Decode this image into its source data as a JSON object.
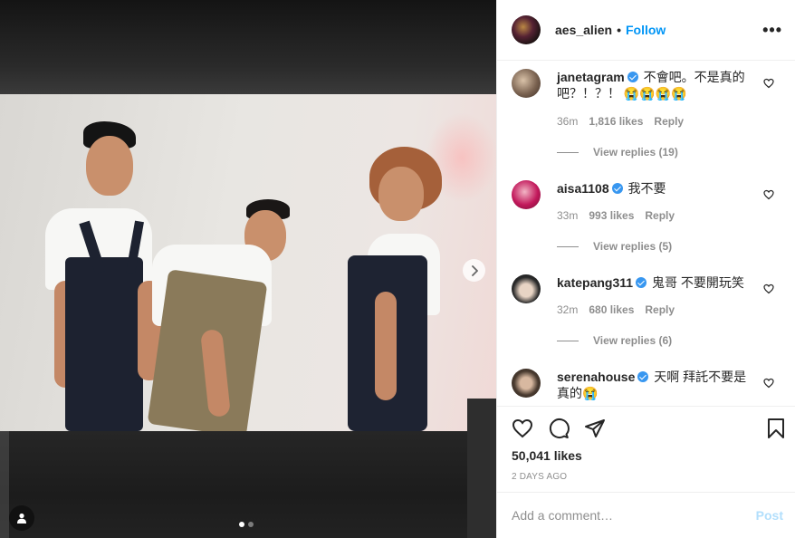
{
  "post": {
    "author": "aes_alien",
    "separator": "•",
    "follow_label": "Follow",
    "more_label": "•••",
    "carousel": {
      "slide_count": 2,
      "active_slide": 1
    }
  },
  "comments": [
    {
      "user": "janetagram",
      "verified": true,
      "text": "不會吧。不是真的吧？！？！ 😭😭😭😭",
      "time": "36m",
      "likes": "1,816 likes",
      "reply": "Reply",
      "view_replies": "View replies (19)",
      "avatar_color": "#6e5a4c"
    },
    {
      "user": "aisa1108",
      "verified": true,
      "text": "我不要",
      "time": "33m",
      "likes": "993 likes",
      "reply": "Reply",
      "view_replies": "View replies (5)",
      "avatar_color": "#c2185b"
    },
    {
      "user": "katepang311",
      "verified": true,
      "text": "鬼哥 不要開玩笑",
      "time": "32m",
      "likes": "680 likes",
      "reply": "Reply",
      "view_replies": "View replies (6)",
      "avatar_color": "#2b2b2b"
    },
    {
      "user": "serenahouse",
      "verified": true,
      "text": "天啊 拜託不要是真的😭",
      "avatar_color": "#4a3b30"
    }
  ],
  "actions": {
    "likes_total": "50,041 likes",
    "posted": "2 DAYS AGO",
    "comment_placeholder": "Add a comment…",
    "post_label": "Post"
  },
  "icons": {
    "like": "heart-icon",
    "comment": "comment-icon",
    "share": "paper-plane-icon",
    "save": "bookmark-icon",
    "next": "chevron-right-icon",
    "tagged_user": "user-icon"
  },
  "colors": {
    "follow_blue": "#0095f6",
    "post_disabled": "#b2dffc",
    "verified": "#3897f0",
    "muted": "#8e8e8e"
  }
}
